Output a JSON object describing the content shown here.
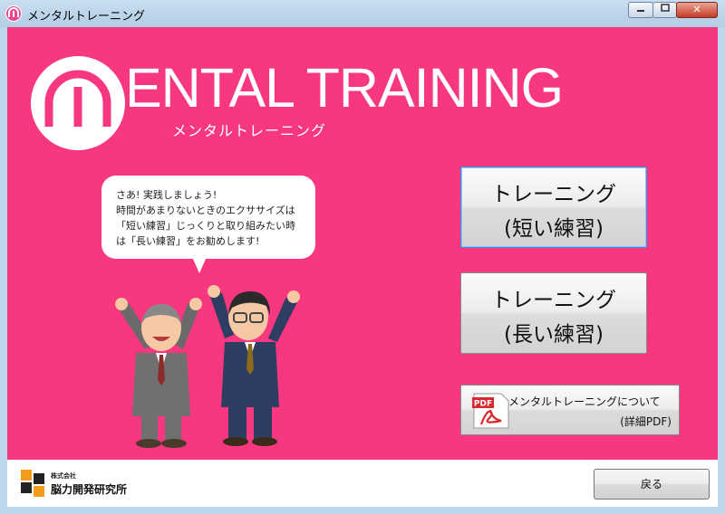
{
  "window": {
    "title": "メンタルトレーニング",
    "controls": {
      "minimize": "▭",
      "maximize": "□",
      "close": "✕"
    }
  },
  "header": {
    "logo_text": "ENTAL TRAINING",
    "logo_subtitle": "メンタルトレーニング"
  },
  "bubble": {
    "lines": [
      "さあ! 実践しましょう!",
      "時間があまりないときのエクササイズは",
      "「短い練習」じっくりと取り組みたい時",
      "は「長い練習」をお勧めします!"
    ]
  },
  "buttons": {
    "short": {
      "line1": "トレーニング",
      "line2": "(短い練習)"
    },
    "long": {
      "line1": "トレーニング",
      "line2": "(長い練習)"
    },
    "pdf": {
      "line1": "メンタルトレーニングについて",
      "line2": "(詳細PDF)",
      "icon_label": "PDF"
    },
    "back": "戻る"
  },
  "footer": {
    "company_prefix": "株式会社",
    "company_name": "脳力開発研究所"
  },
  "colors": {
    "background": "#f7377f",
    "footer": "#ffffff",
    "pdf_red": "#d9272e"
  }
}
